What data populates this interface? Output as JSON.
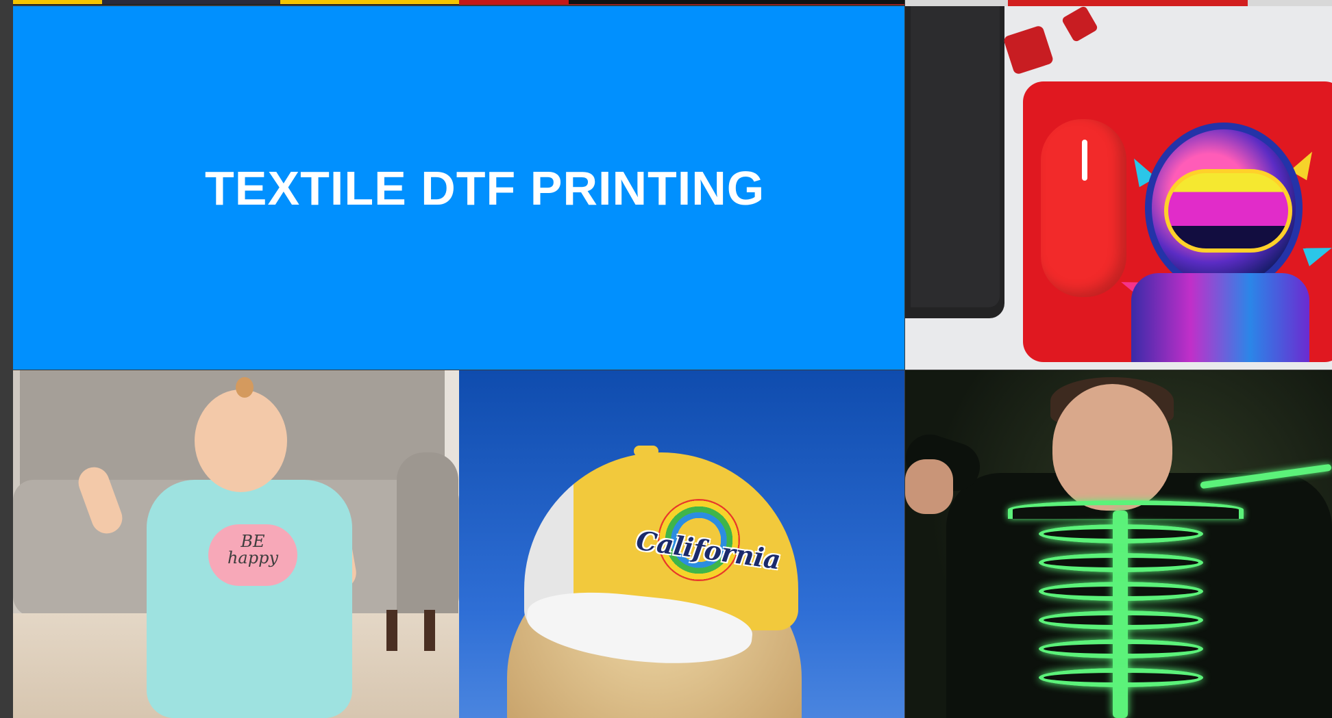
{
  "hero": {
    "title": "TEXTILE DTF PRINTING",
    "background_color": "#0190fe"
  },
  "tiles": [
    {
      "name": "mousepad-product",
      "artwork": "astronaut"
    },
    {
      "name": "baby-bodysuit-product",
      "print_text": "BE happy"
    },
    {
      "name": "cap-product",
      "print_text": "California"
    },
    {
      "name": "glow-skeleton-sweater-product"
    }
  ]
}
